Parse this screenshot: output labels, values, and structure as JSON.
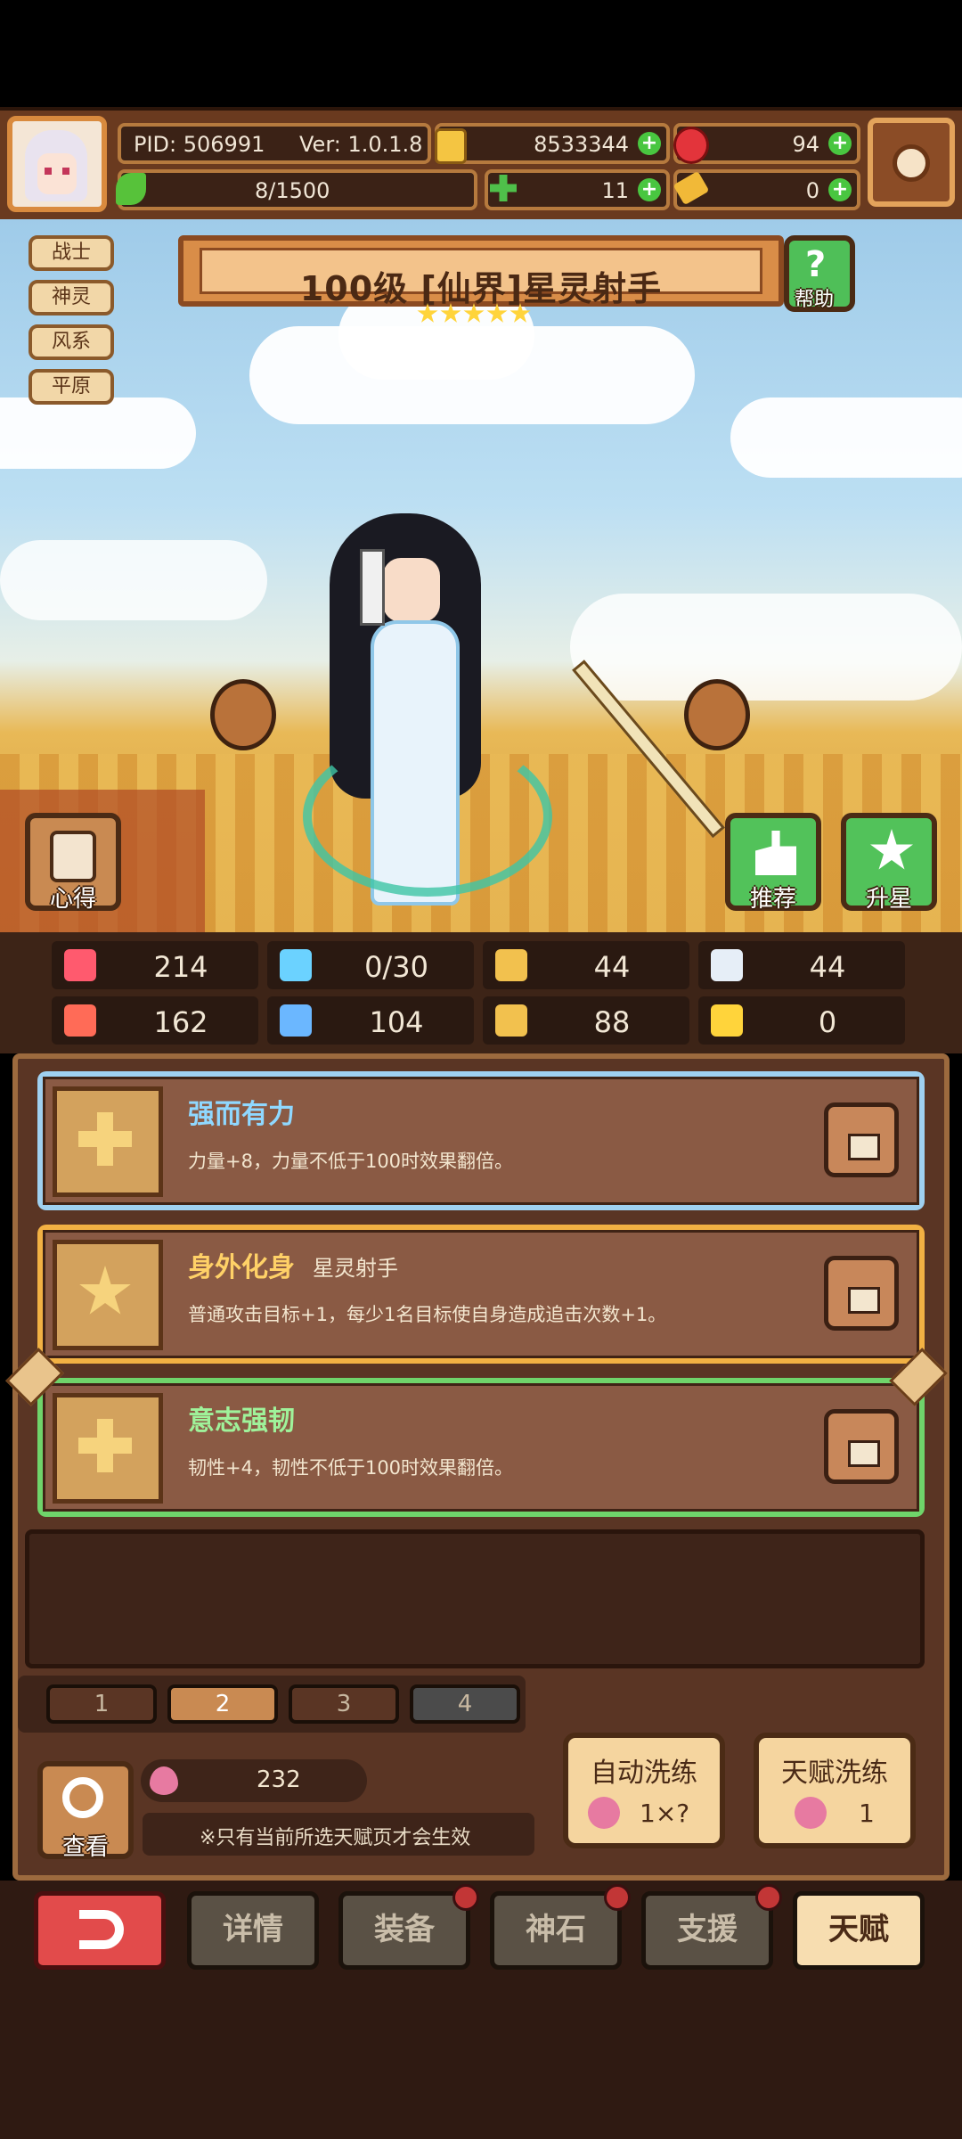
{
  "header": {
    "pid": "PID: 506991",
    "version": "Ver: 1.0.1.8",
    "gold": "8533344",
    "gems": "94",
    "stamina": "8/1500",
    "clover": "11",
    "key": "0"
  },
  "tags": [
    "战士",
    "神灵",
    "风系",
    "平原"
  ],
  "hero": {
    "title": "100级 [仙界]星灵射手",
    "stars": 5,
    "help_label": "帮助"
  },
  "actions": {
    "insight_label": "心得",
    "recommend_label": "推荐",
    "upstar_label": "升星"
  },
  "stats": [
    {
      "icon": "heart-icon",
      "value": "214",
      "color": "#ff5a6e"
    },
    {
      "icon": "water-drop-icon",
      "value": "0/30",
      "color": "#6bd2ff"
    },
    {
      "icon": "shield-icon",
      "value": "44",
      "color": "#f2c14e"
    },
    {
      "icon": "wing-icon",
      "value": "44",
      "color": "#e6eef7"
    },
    {
      "icon": "fist-icon",
      "value": "162",
      "color": "#ff6b57"
    },
    {
      "icon": "book-icon",
      "value": "104",
      "color": "#6bb7ff"
    },
    {
      "icon": "boot-icon",
      "value": "88",
      "color": "#f2c14e"
    },
    {
      "icon": "horseshoe-icon",
      "value": "0",
      "color": "#ffd43b"
    }
  ],
  "talents": [
    {
      "name": "强而有力",
      "sub": "",
      "desc": "力量+8，力量不低于100时效果翻倍。",
      "frame": "#9fd0f0",
      "name_color": "#8fd8ff",
      "icon": "plus-icon"
    },
    {
      "name": "身外化身",
      "sub": "星灵射手",
      "desc": "普通攻击目标+1，每少1名目标使自身造成追击次数+1。",
      "frame": "#f2b143",
      "name_color": "#ffd167",
      "icon": "star-icon"
    },
    {
      "name": "意志强韧",
      "sub": "",
      "desc": "韧性+4，韧性不低于100时效果翻倍。",
      "frame": "#6fd46a",
      "name_color": "#9ff29a",
      "icon": "plus-icon"
    }
  ],
  "pages": [
    "1",
    "2",
    "3",
    "4"
  ],
  "active_page": "2",
  "footer": {
    "view_label": "查看",
    "peach_count": "232",
    "note": "※只有当前所选天赋页才会生效",
    "auto_refine_label": "自动洗练",
    "auto_refine_cost": "1×?",
    "talent_refine_label": "天赋洗练",
    "talent_refine_cost": "1"
  },
  "nav": {
    "back": "back-arrow-icon",
    "items": [
      "详情",
      "装备",
      "神石",
      "支援",
      "天赋"
    ],
    "active": "天赋"
  }
}
